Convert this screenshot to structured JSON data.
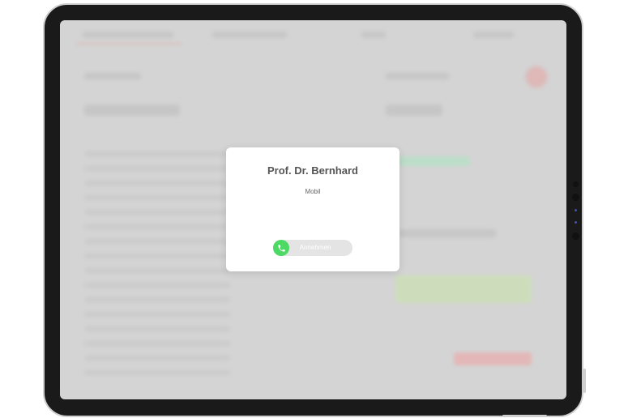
{
  "incoming_call": {
    "caller_name": "Prof. Dr. Bernhard",
    "call_type": "Mobil",
    "answer_label": "Annehmen",
    "answer_color": "#4cd964",
    "icon": "phone-icon"
  },
  "device": {
    "frame_color": "#1a1a1a",
    "screen_overlay_color": "#d4d4d4"
  }
}
